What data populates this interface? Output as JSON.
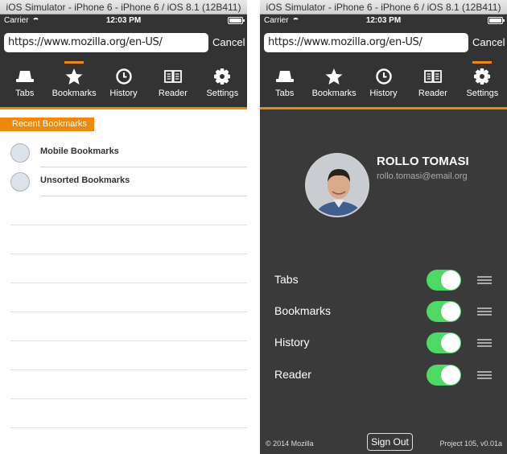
{
  "left": {
    "window_title": "iOS Simulator - iPhone 6 - iPhone 6 / iOS 8.1 (12B411)",
    "status": {
      "carrier": "Carrier",
      "time": "12:03 PM"
    },
    "url": "https://www.mozilla.org/en-US/",
    "cancel_label": "Cancel",
    "tabs": [
      {
        "label": "Tabs",
        "icon": "tabs-hat-icon"
      },
      {
        "label": "Bookmarks",
        "icon": "star-icon"
      },
      {
        "label": "History",
        "icon": "clock-icon"
      },
      {
        "label": "Reader",
        "icon": "book-icon"
      },
      {
        "label": "Settings",
        "icon": "gear-icon"
      }
    ],
    "active_tab": "Bookmarks",
    "section_header": "Recent Bookmarks",
    "bookmarks": [
      {
        "label": "Mobile Bookmarks"
      },
      {
        "label": "Unsorted Bookmarks"
      }
    ]
  },
  "right": {
    "window_title": "iOS Simulator - iPhone 6 - iPhone 6 / iOS 8.1 (12B411)",
    "status": {
      "carrier": "Carrier",
      "time": "12:03 PM"
    },
    "url": "https://www.mozilla.org/en-US/",
    "cancel_label": "Cancel",
    "tabs": [
      {
        "label": "Tabs",
        "icon": "tabs-hat-icon"
      },
      {
        "label": "Bookmarks",
        "icon": "star-icon"
      },
      {
        "label": "History",
        "icon": "clock-icon"
      },
      {
        "label": "Reader",
        "icon": "book-icon"
      },
      {
        "label": "Settings",
        "icon": "gear-icon"
      }
    ],
    "active_tab": "Settings",
    "user": {
      "name": "ROLLO TOMASI",
      "email": "rollo.tomasi@email.org"
    },
    "prefs": [
      {
        "label": "Tabs",
        "enabled": true
      },
      {
        "label": "Bookmarks",
        "enabled": true
      },
      {
        "label": "History",
        "enabled": true
      },
      {
        "label": "Reader",
        "enabled": true
      }
    ],
    "footer_left": "© 2014 Mozilla",
    "signout_label": "Sign Out",
    "footer_right": "Project 105, v0.01a"
  },
  "colors": {
    "accent": "#f0880c",
    "header_bg": "#333333",
    "panel_bg": "#3a3a3a",
    "toggle_on": "#4cd964"
  }
}
